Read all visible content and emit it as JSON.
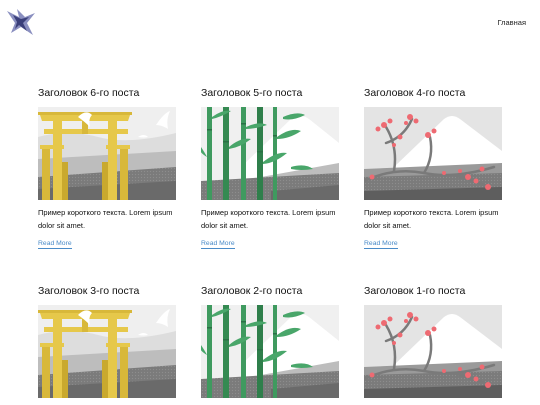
{
  "header": {
    "nav": [
      "Главная"
    ]
  },
  "posts": [
    {
      "title": "Заголовок 6-го поста",
      "excerpt": "Пример короткого текста. Lorem ipsum dolor sit amet.",
      "read_more": "Read More",
      "image": "torii-gate"
    },
    {
      "title": "Заголовок 5-го поста",
      "excerpt": "Пример короткого текста. Lorem ipsum dolor sit amet.",
      "read_more": "Read More",
      "image": "bamboo"
    },
    {
      "title": "Заголовок 4-го поста",
      "excerpt": "Пример короткого текста. Lorem ipsum dolor sit amet.",
      "read_more": "Read More",
      "image": "sakura-mountain"
    },
    {
      "title": "Заголовок 3-го поста",
      "image": "torii-gate"
    },
    {
      "title": "Заголовок 2-го поста",
      "image": "bamboo"
    },
    {
      "title": "Заголовок 1-го поста",
      "image": "sakura-mountain"
    }
  ],
  "colors": {
    "link": "#4a8bc8",
    "torii": "#e6c84a",
    "bamboo": "#3f9a5f",
    "blossom": "#ee6a72"
  }
}
